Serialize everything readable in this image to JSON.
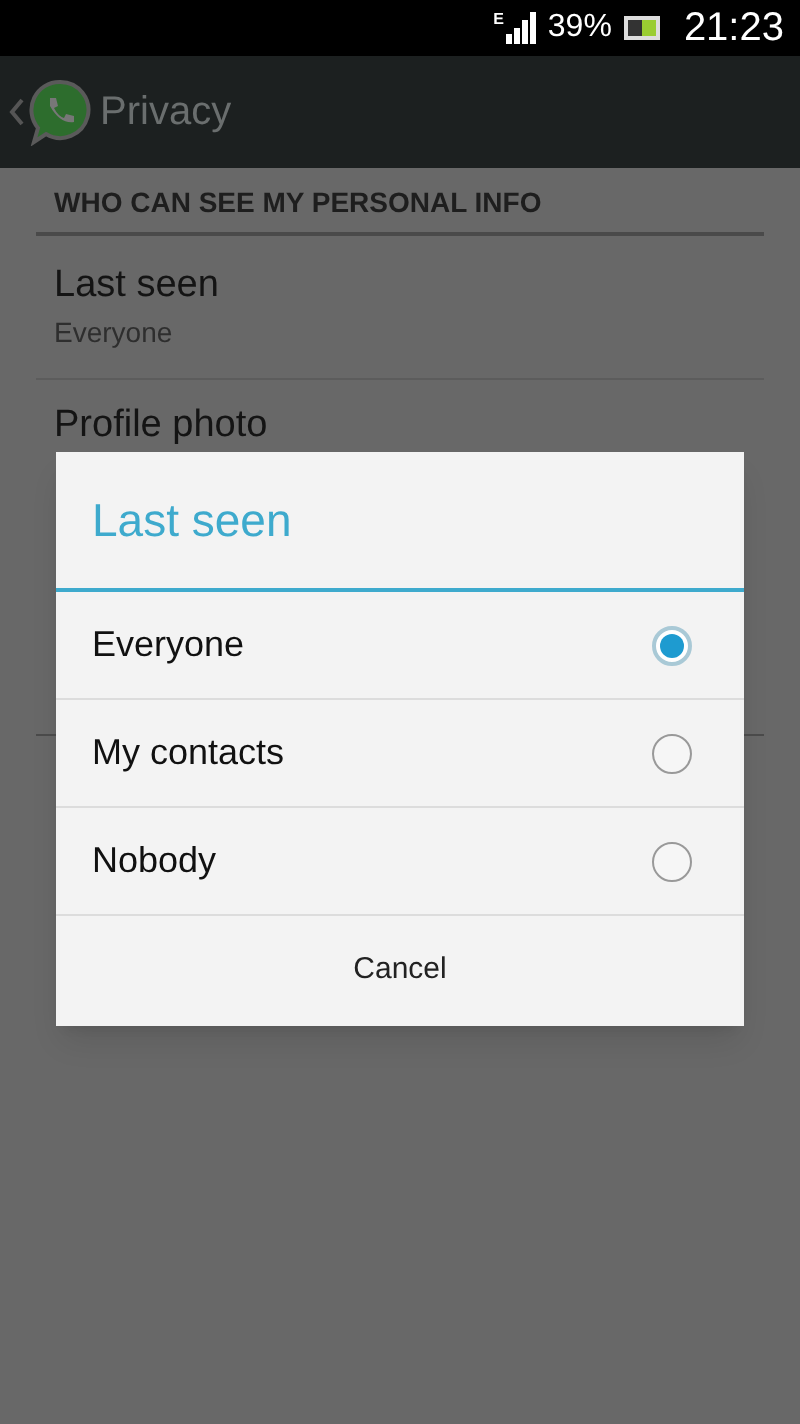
{
  "status_bar": {
    "network": "E",
    "battery": "39%",
    "time": "21:23"
  },
  "action_bar": {
    "title": "Privacy"
  },
  "section": {
    "header": "WHO CAN SEE MY PERSONAL INFO"
  },
  "settings": [
    {
      "title": "Last seen",
      "summary": "Everyone"
    },
    {
      "title": "Profile photo"
    }
  ],
  "dialog": {
    "title": "Last seen",
    "options": [
      {
        "label": "Everyone",
        "selected": true
      },
      {
        "label": "My contacts",
        "selected": false
      },
      {
        "label": "Nobody",
        "selected": false
      }
    ],
    "cancel": "Cancel"
  }
}
